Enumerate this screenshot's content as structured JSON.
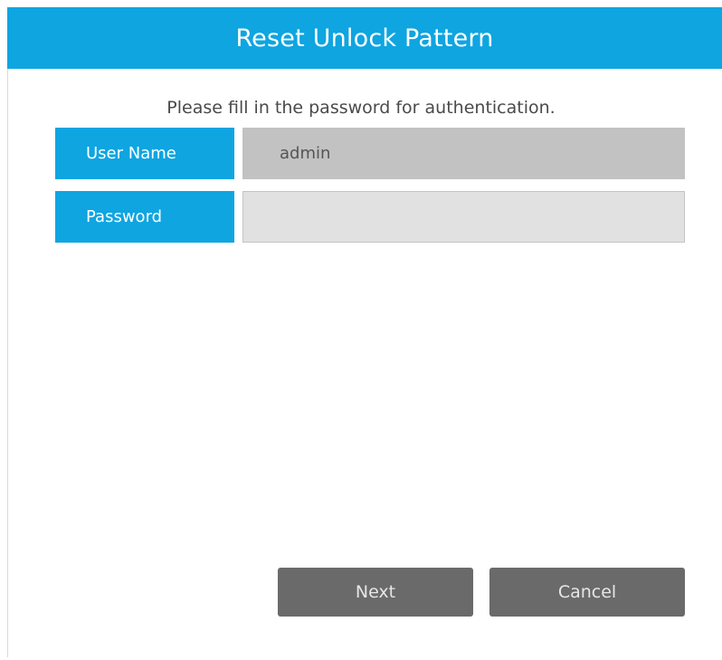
{
  "dialog": {
    "title": "Reset Unlock Pattern",
    "instruction": "Please fill in the password for authentication."
  },
  "form": {
    "username_label": "User Name",
    "username_value": "admin",
    "password_label": "Password",
    "password_value": ""
  },
  "buttons": {
    "next_label": "Next",
    "cancel_label": "Cancel"
  },
  "colors": {
    "accent": "#0ea5e1",
    "button_bg": "#6a6a6a",
    "username_bg": "#c2c2c2",
    "password_bg": "#e1e1e1"
  }
}
